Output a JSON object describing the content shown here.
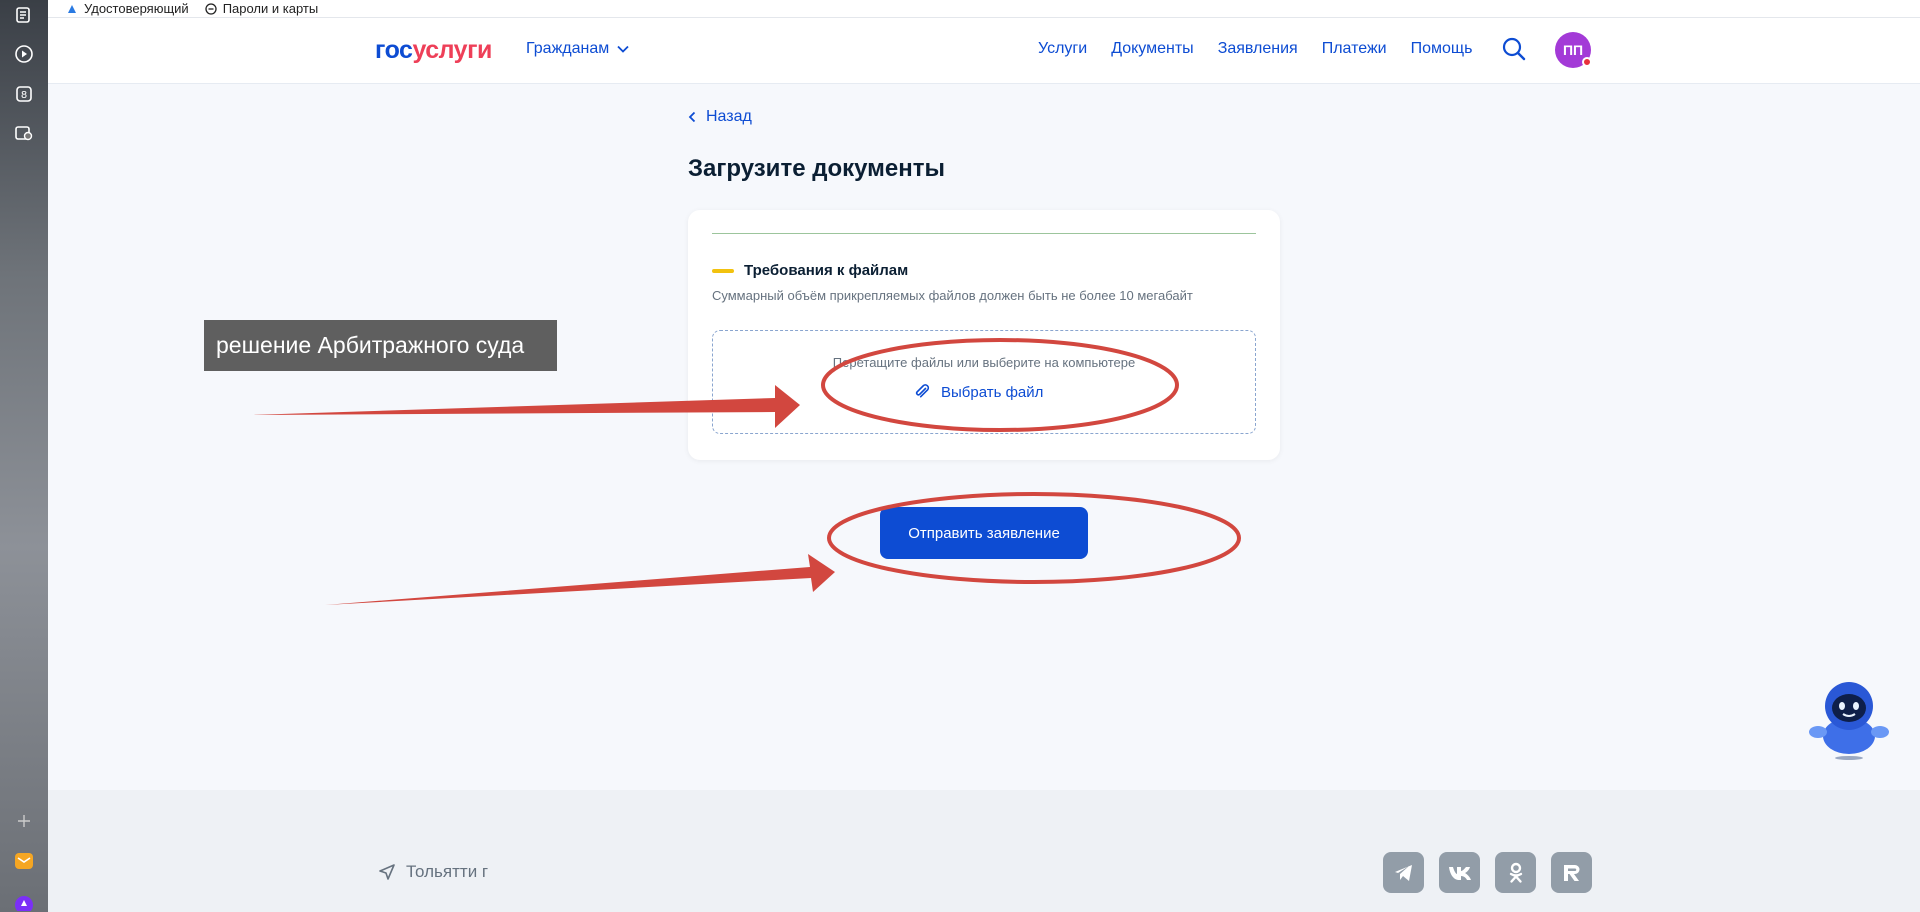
{
  "bookmarks": [
    {
      "label": "Удостоверяющий"
    },
    {
      "label": "Пароли и карты"
    }
  ],
  "header": {
    "logo_part1": "гос",
    "logo_part2": "услуги",
    "citizens": "Гражданам",
    "nav": [
      "Услуги",
      "Документы",
      "Заявления",
      "Платежи",
      "Помощь"
    ],
    "avatar_initials": "ПП"
  },
  "content": {
    "back": "Назад",
    "title": "Загрузите документы",
    "requirements_title": "Требования к файлам",
    "requirements_text": "Суммарный объём прикрепляемых файлов должен быть не более 10 мегабайт",
    "dropzone_text": "Перетащите файлы или выберите на компьютере",
    "choose_file": "Выбрать файл",
    "submit": "Отправить заявление"
  },
  "annotation": {
    "label": "решение Арбитражного суда"
  },
  "footer": {
    "city": "Тольятти г",
    "socials": [
      "telegram-icon",
      "vk-icon",
      "ok-icon",
      "rutube-icon"
    ]
  },
  "colors": {
    "brand_blue": "#0d4cd3",
    "brand_red": "#ee3f58",
    "annotation_red": "#d2473f",
    "avatar": "#a33ad7"
  }
}
